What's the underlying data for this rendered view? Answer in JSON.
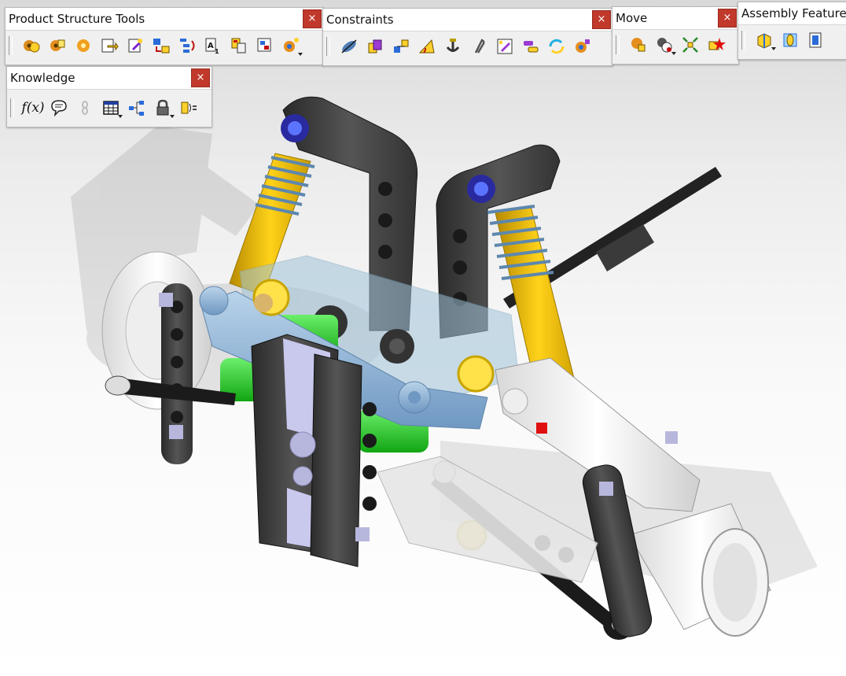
{
  "toolbars": {
    "product_structure": {
      "title": "Product Structure Tools",
      "close": "×"
    },
    "constraints": {
      "title": "Constraints",
      "close": "×"
    },
    "move": {
      "title": "Move",
      "close": "×"
    },
    "assembly_features": {
      "title": "Assembly Features",
      "close": "×"
    },
    "knowledge": {
      "title": "Knowledge",
      "close": "×",
      "formula_label": "f(x)"
    }
  },
  "icons": {
    "product_structure": [
      "component-icon",
      "product-icon",
      "part-icon",
      "existing-component-icon",
      "existing-component-positioning-icon",
      "replace-component-icon",
      "graph-tree-reordering-icon",
      "generate-numbering-icon",
      "selective-load-icon",
      "manage-representations-icon",
      "multi-instantiation-icon"
    ],
    "constraints": [
      "coincidence-icon",
      "contact-icon",
      "offset-icon",
      "angle-icon",
      "fix-icon",
      "fix-together-icon",
      "quick-constraint-icon",
      "flexible-rigid-icon",
      "change-constraint-icon",
      "reuse-pattern-icon"
    ],
    "move": [
      "manipulation-icon",
      "snap-icon",
      "explode-icon",
      "stop-manipulate-icon"
    ],
    "assembly_features": [
      "split-icon",
      "hole-icon",
      "pocket-icon"
    ],
    "knowledge": [
      "formula-icon",
      "comment-icon",
      "rule-icon",
      "design-table-icon",
      "knowledge-tree-icon",
      "lock-icon",
      "equivalent-dimensions-icon"
    ]
  },
  "colors": {
    "close_button": "#c0392b",
    "toolbar_bg": "#f0f0f0",
    "viewport_top": "#d9d9d9",
    "viewport_bottom": "#ffffff"
  }
}
